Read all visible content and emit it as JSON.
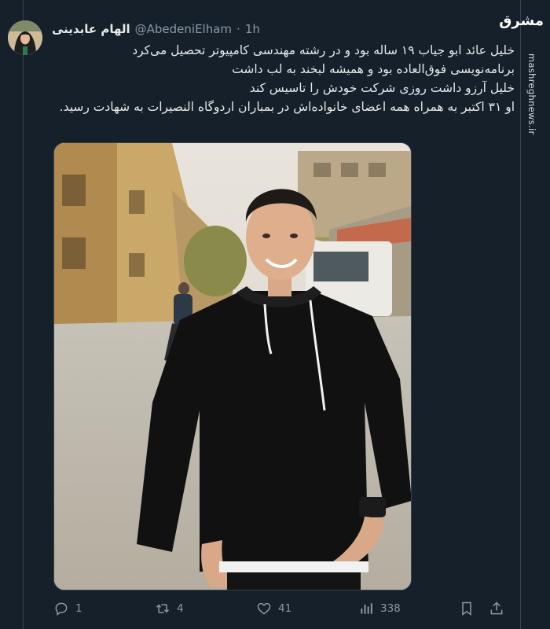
{
  "user": {
    "display_name": "الهام عابدینی",
    "handle": "@AbedeniElham",
    "separator": "·",
    "time": "1h"
  },
  "tweet": {
    "lines": [
      "خلیل عائد ابو جیاب ۱۹ ساله بود و در رشته مهندسی کامپیوتر تحصیل می‌کرد",
      "برنامه‌نویسی فوق‌العاده بود و همیشه لبخند به لب داشت",
      "خلیل آرزو داشت روزی شرکت خودش را تاسیس کند",
      "او ۳۱ اکتبر به همراه همه اعضای خانواده‌اش در بمباران اردوگاه النصیرات به شهادت رسید."
    ]
  },
  "watermark": {
    "logo": "مشرق",
    "site": "mashreghnews.ir"
  },
  "actions": {
    "reply": {
      "icon": "reply-icon",
      "count": "1"
    },
    "retweet": {
      "icon": "retweet-icon",
      "count": "4"
    },
    "like": {
      "icon": "heart-icon",
      "count": "41"
    },
    "views": {
      "icon": "views-icon",
      "count": "338"
    },
    "bookmark": {
      "icon": "bookmark-icon"
    },
    "share": {
      "icon": "share-icon"
    }
  },
  "colors": {
    "background": "#15202b",
    "text": "#e7e9ea",
    "muted": "#8b98a5",
    "border": "#38444d"
  }
}
